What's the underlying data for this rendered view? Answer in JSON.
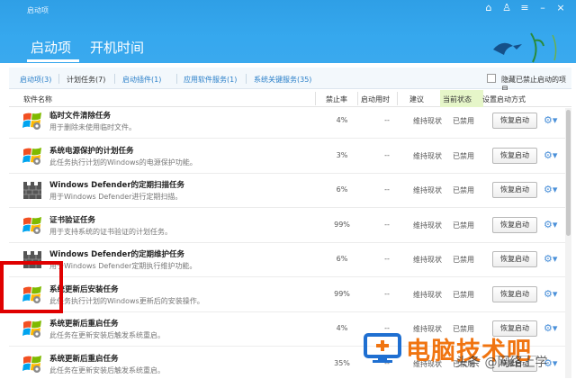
{
  "header": {
    "app_name": "启动项",
    "tabs": [
      "启动项",
      "开机时间"
    ]
  },
  "filters": {
    "items": [
      "启动项(3)",
      "计划任务(7)",
      "启动插件(1)",
      "应用软件服务(1)",
      "系统关键服务(35)"
    ],
    "hide_label": "隐藏已禁止启动的项目"
  },
  "columns": {
    "name": "软件名称",
    "rate": "禁止率",
    "time": "启动用时",
    "advice": "建议",
    "status": "当前状态",
    "method": "设置启动方式"
  },
  "rows": [
    {
      "title": "临时文件清除任务",
      "desc": "用于删除未使用临时文件。",
      "rate": "4%",
      "time": "--",
      "advice": "维持现状",
      "status": "已禁用",
      "button": "恢复启动",
      "icon": "windows-logo"
    },
    {
      "title": "系统电源保护的计划任务",
      "desc": "此任务执行计划的Windows的电源保护功能。",
      "rate": "3%",
      "time": "--",
      "advice": "维持现状",
      "status": "已禁用",
      "button": "恢复启动",
      "icon": "windows-logo"
    },
    {
      "title": "Windows Defender的定期扫描任务",
      "desc": "用于Windows Defender进行定期扫描。",
      "rate": "6%",
      "time": "--",
      "advice": "维持现状",
      "status": "已禁用",
      "button": "恢复启动",
      "icon": "castle-wall"
    },
    {
      "title": "证书验证任务",
      "desc": "用于支持系统的证书验证的计划任务。",
      "rate": "99%",
      "time": "--",
      "advice": "维持现状",
      "status": "已禁用",
      "button": "恢复启动",
      "icon": "windows-logo"
    },
    {
      "title": "Windows Defender的定期维护任务",
      "desc": "用于Windows Defender定期执行维护功能。",
      "rate": "6%",
      "time": "--",
      "advice": "维持现状",
      "status": "已禁用",
      "button": "恢复启动",
      "icon": "castle-wall"
    },
    {
      "title": "系统更新后安装任务",
      "desc": "此任务执行计划的Windows更新后的安装操作。",
      "rate": "99%",
      "time": "--",
      "advice": "维持现状",
      "status": "已禁用",
      "button": "恢复启动",
      "icon": "windows-logo"
    },
    {
      "title": "系统更新后重启任务",
      "desc": "此任务在更新安装后触发系统重启。",
      "rate": "4%",
      "time": "--",
      "advice": "维持现状",
      "status": "已禁用",
      "button": "恢复启动",
      "icon": "windows-logo"
    },
    {
      "title": "系统更新后重启任务",
      "desc": "此任务在更新安装后触发系统重启。",
      "rate": "35%",
      "time": "--",
      "advice": "维持现状",
      "status": "已禁用",
      "button": "恢复启动",
      "icon": "windows-logo"
    }
  ],
  "watermark": {
    "text": "电脑技术吧",
    "sub": "头条 @网络上学"
  },
  "colors": {
    "header_blue": "#36a8ee",
    "current_status_bg": "#e6f6c9",
    "highlight_red": "#e00000",
    "watermark_orange": "#f07410"
  }
}
